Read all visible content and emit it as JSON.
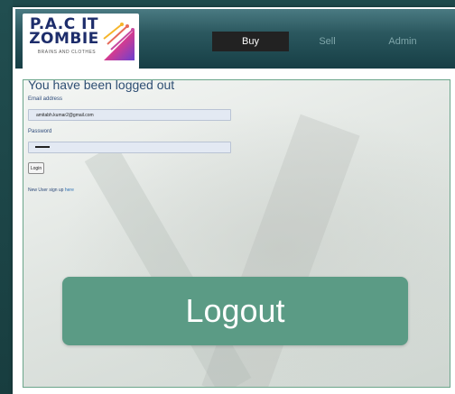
{
  "brand": {
    "logo_title": "P.A.C IT\nZOMBIE",
    "logo_subtitle": "BRAINS AND CLOTHES"
  },
  "nav": {
    "items": [
      {
        "label": "Buy",
        "active": true
      },
      {
        "label": "Sell",
        "active": false
      },
      {
        "label": "Admin",
        "active": false
      }
    ]
  },
  "page": {
    "title": "You have been logged out"
  },
  "form": {
    "email_label": "Email address",
    "email_value": "amitabh.kumar2@gmail.com",
    "password_label": "Password",
    "login_button": "Login",
    "new_user_text": "New User sign up ",
    "new_user_link": "here"
  },
  "overlay": {
    "banner_text": "Logout"
  },
  "colors": {
    "accent_green": "#5b9b85",
    "navbar_dark": "#163e45",
    "active_nav_bg": "#222222"
  }
}
